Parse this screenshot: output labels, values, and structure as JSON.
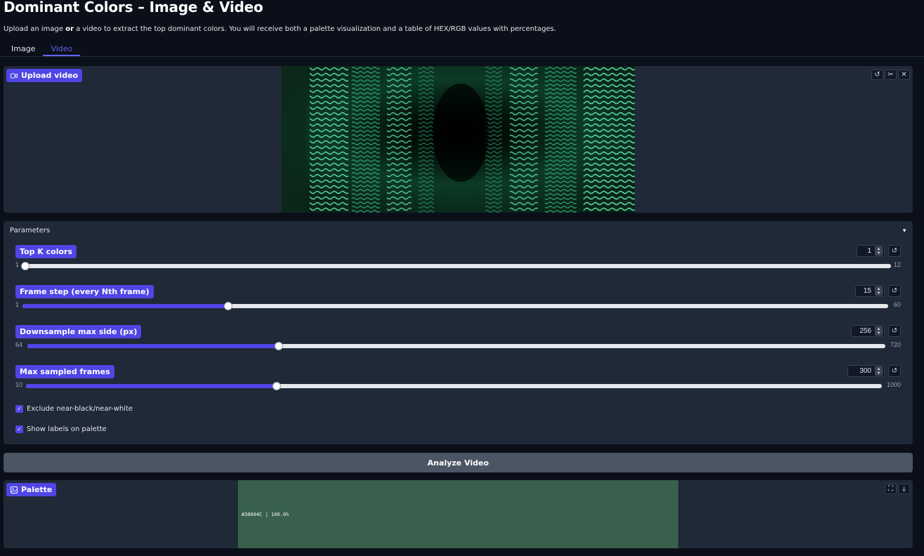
{
  "header": {
    "title": "Dominant Colors – Image & Video",
    "subtitle_pre": "Upload an image ",
    "subtitle_bold": "or",
    "subtitle_post": " a video to extract the top dominant colors. You will receive both a palette visualization and a table of HEX/RGB values with percentages."
  },
  "tabs": [
    {
      "label": "Image",
      "active": false
    },
    {
      "label": "Video",
      "active": true
    }
  ],
  "video_input": {
    "label": "Upload video",
    "icons": [
      "undo-icon",
      "scissors-icon",
      "close-icon"
    ]
  },
  "parameters": {
    "header": "Parameters",
    "controls": [
      {
        "label": "Top K colors",
        "value": "1",
        "min": "1",
        "max": "12",
        "fraction": 0.0
      },
      {
        "label": "Frame step (every Nth frame)",
        "value": "15",
        "min": "1",
        "max": "60",
        "fraction": 0.2373
      },
      {
        "label": "Downsample max side (px)",
        "value": "256",
        "min": "64",
        "max": "720",
        "fraction": 0.2927
      },
      {
        "label": "Max sampled frames",
        "value": "300",
        "min": "10",
        "max": "1000",
        "fraction": 0.2929
      }
    ],
    "checkboxes": [
      {
        "label": "Exclude near-black/near-white",
        "checked": true
      },
      {
        "label": "Show labels on palette",
        "checked": true
      }
    ]
  },
  "analyze_button": "Analyze Video",
  "palette": {
    "label": "Palette",
    "swatches": [
      {
        "hex": "#38604C",
        "label": "#38604C | 100.0%"
      }
    ]
  },
  "colors": {
    "accent": "#4f46e5",
    "background": "#0b0f19",
    "panel": "#1f2937",
    "button": "#4b5563"
  }
}
